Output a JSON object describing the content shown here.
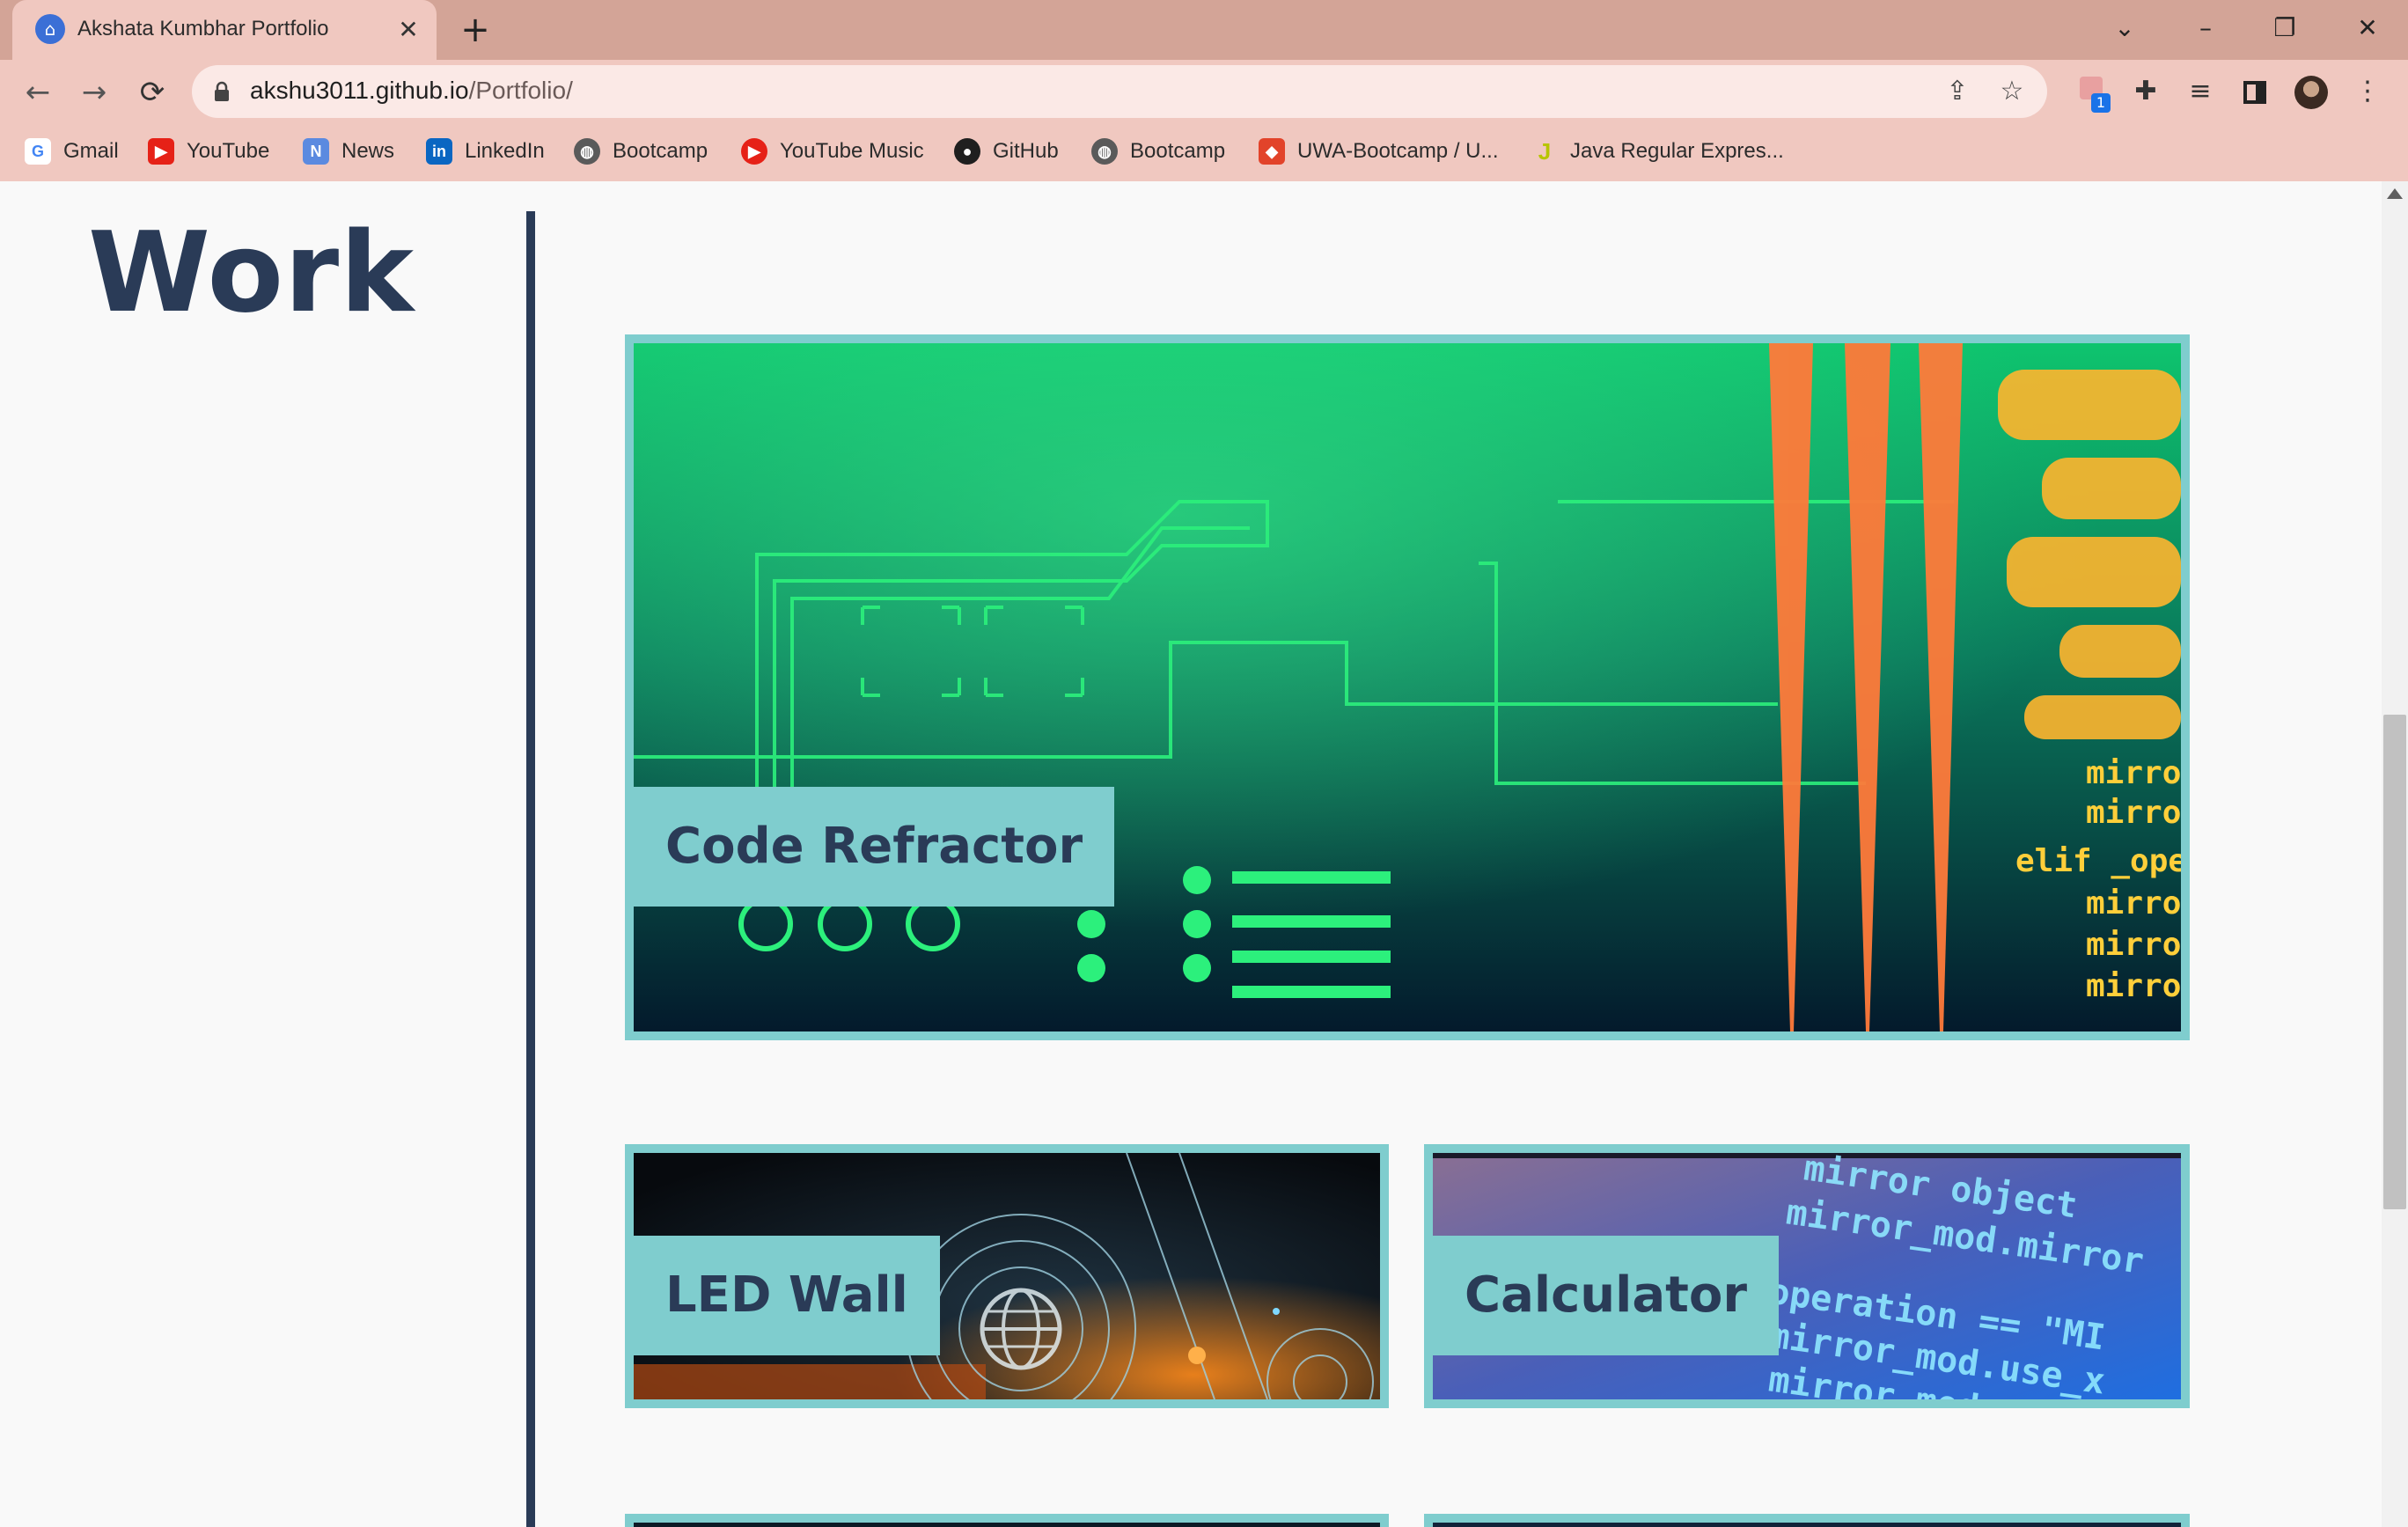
{
  "browser": {
    "tab_title": "Akshata Kumbhar Portfolio",
    "tab_close": "✕",
    "new_tab": "+",
    "url_host": "akshu3011.github.io",
    "url_path": "/Portfolio/",
    "window": {
      "menu": "⌄",
      "minimize": "–",
      "restore": "❐",
      "close": "✕"
    },
    "nav": {
      "back": "←",
      "forward": "→",
      "reload": "⟳"
    },
    "ext_badge": "1"
  },
  "bookmarks": [
    {
      "label": "Gmail",
      "icon": "G",
      "color": "#4285f4"
    },
    {
      "label": "YouTube",
      "icon": "▶",
      "color": "#e62117"
    },
    {
      "label": "News",
      "icon": "N",
      "color": "#5b8ae0"
    },
    {
      "label": "LinkedIn",
      "icon": "in",
      "color": "#0a66c2"
    },
    {
      "label": "Bootcamp",
      "icon": "◍",
      "color": "#5a5a5a"
    },
    {
      "label": "YouTube Music",
      "icon": "▶",
      "color": "#e62117"
    },
    {
      "label": "GitHub",
      "icon": "●",
      "color": "#1f1f1f"
    },
    {
      "label": "Bootcamp",
      "icon": "◍",
      "color": "#5a5a5a"
    },
    {
      "label": "UWA-Bootcamp / U...",
      "icon": "◆",
      "color": "#e2432a"
    },
    {
      "label": "Java Regular Expres...",
      "icon": "J",
      "color": "#b7c400"
    }
  ],
  "page": {
    "heading": "Work",
    "projects": [
      {
        "title": "Code Refractor"
      },
      {
        "title": "LED Wall"
      },
      {
        "title": "Calculator"
      }
    ]
  },
  "colors": {
    "accent": "#7fcdce",
    "navy": "#2a3b57",
    "chrome": "#f0c8c0"
  }
}
